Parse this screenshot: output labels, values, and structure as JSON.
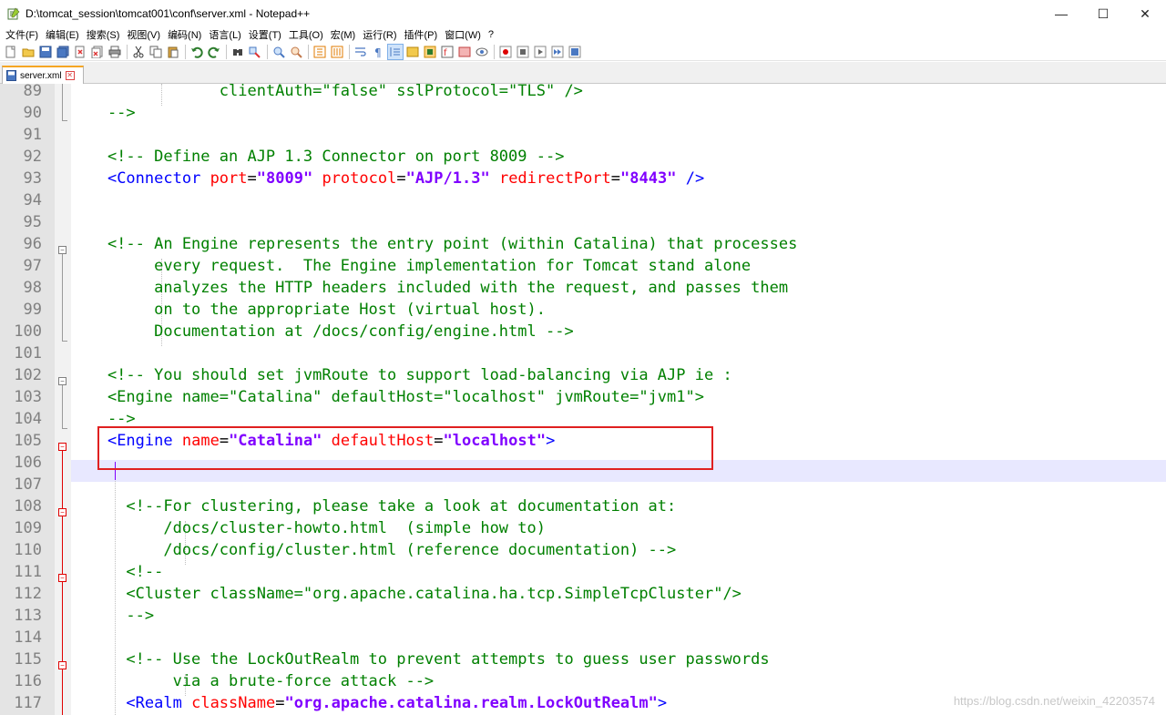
{
  "window": {
    "title": "D:\\tomcat_session\\tomcat001\\conf\\server.xml - Notepad++",
    "minimize": "—",
    "maximize": "☐",
    "close": "✕"
  },
  "menu": [
    "文件(F)",
    "编辑(E)",
    "搜索(S)",
    "视图(V)",
    "编码(N)",
    "语言(L)",
    "设置(T)",
    "工具(O)",
    "宏(M)",
    "运行(R)",
    "插件(P)",
    "窗口(W)",
    "?"
  ],
  "tab": {
    "label": "server.xml",
    "close": "✕"
  },
  "lines": [
    {
      "n": "89",
      "segs": [
        [
          "c-comment",
          "                clientAuth=\"false\" sslProtocol=\"TLS\" />"
        ]
      ]
    },
    {
      "n": "90",
      "segs": [
        [
          "c-comment",
          "    -->"
        ]
      ]
    },
    {
      "n": "91",
      "segs": []
    },
    {
      "n": "92",
      "segs": [
        [
          "c-comment",
          "    <!-- Define an AJP 1.3 Connector on port 8009 -->"
        ]
      ]
    },
    {
      "n": "93",
      "segs": [
        [
          "c-plain",
          "    "
        ],
        [
          "c-tag",
          "<Connector"
        ],
        [
          "c-plain",
          " "
        ],
        [
          "c-attr",
          "port"
        ],
        [
          "c-plain",
          "="
        ],
        [
          "c-val",
          "\"8009\""
        ],
        [
          "c-plain",
          " "
        ],
        [
          "c-attr",
          "protocol"
        ],
        [
          "c-plain",
          "="
        ],
        [
          "c-val",
          "\"AJP/1.3\""
        ],
        [
          "c-plain",
          " "
        ],
        [
          "c-attr",
          "redirectPort"
        ],
        [
          "c-plain",
          "="
        ],
        [
          "c-val",
          "\"8443\""
        ],
        [
          "c-plain",
          " "
        ],
        [
          "c-tag",
          "/>"
        ]
      ]
    },
    {
      "n": "94",
      "segs": []
    },
    {
      "n": "95",
      "segs": []
    },
    {
      "n": "96",
      "segs": [
        [
          "c-comment",
          "    <!-- An Engine represents the entry point (within Catalina) that processes"
        ]
      ]
    },
    {
      "n": "97",
      "segs": [
        [
          "c-comment",
          "         every request.  The Engine implementation for Tomcat stand alone"
        ]
      ]
    },
    {
      "n": "98",
      "segs": [
        [
          "c-comment",
          "         analyzes the HTTP headers included with the request, and passes them"
        ]
      ]
    },
    {
      "n": "99",
      "segs": [
        [
          "c-comment",
          "         on to the appropriate Host (virtual host)."
        ]
      ]
    },
    {
      "n": "100",
      "segs": [
        [
          "c-comment",
          "         Documentation at /docs/config/engine.html -->"
        ]
      ]
    },
    {
      "n": "101",
      "segs": []
    },
    {
      "n": "102",
      "segs": [
        [
          "c-comment",
          "    <!-- You should set jvmRoute to support load-balancing via AJP ie :"
        ]
      ]
    },
    {
      "n": "103",
      "segs": [
        [
          "c-comment",
          "    <Engine name=\"Catalina\" defaultHost=\"localhost\" jvmRoute=\"jvm1\">"
        ]
      ]
    },
    {
      "n": "104",
      "segs": [
        [
          "c-comment",
          "    -->"
        ]
      ]
    },
    {
      "n": "105",
      "segs": [
        [
          "c-plain",
          "    "
        ],
        [
          "c-tag",
          "<Engine"
        ],
        [
          "c-plain",
          " "
        ],
        [
          "c-attr",
          "name"
        ],
        [
          "c-plain",
          "="
        ],
        [
          "c-val",
          "\"Catalina\""
        ],
        [
          "c-plain",
          " "
        ],
        [
          "c-attr",
          "defaultHost"
        ],
        [
          "c-plain",
          "="
        ],
        [
          "c-val",
          "\"localhost\""
        ],
        [
          "c-tag",
          ">"
        ]
      ]
    },
    {
      "n": "106",
      "segs": []
    },
    {
      "n": "107",
      "segs": []
    },
    {
      "n": "108",
      "segs": [
        [
          "c-comment",
          "      <!--For clustering, please take a look at documentation at:"
        ]
      ]
    },
    {
      "n": "109",
      "segs": [
        [
          "c-comment",
          "          /docs/cluster-howto.html  (simple how to)"
        ]
      ]
    },
    {
      "n": "110",
      "segs": [
        [
          "c-comment",
          "          /docs/config/cluster.html (reference documentation) -->"
        ]
      ]
    },
    {
      "n": "111",
      "segs": [
        [
          "c-comment",
          "      <!--"
        ]
      ]
    },
    {
      "n": "112",
      "segs": [
        [
          "c-comment",
          "      <Cluster className=\"org.apache.catalina.ha.tcp.SimpleTcpCluster\"/>"
        ]
      ]
    },
    {
      "n": "113",
      "segs": [
        [
          "c-comment",
          "      -->"
        ]
      ]
    },
    {
      "n": "114",
      "segs": []
    },
    {
      "n": "115",
      "segs": [
        [
          "c-comment",
          "      <!-- Use the LockOutRealm to prevent attempts to guess user passwords"
        ]
      ]
    },
    {
      "n": "116",
      "segs": [
        [
          "c-comment",
          "           via a brute-force attack -->"
        ]
      ]
    },
    {
      "n": "117",
      "segs": [
        [
          "c-plain",
          "      "
        ],
        [
          "c-tag",
          "<Realm"
        ],
        [
          "c-plain",
          " "
        ],
        [
          "c-attr",
          "className"
        ],
        [
          "c-plain",
          "="
        ],
        [
          "c-val",
          "\"org.apache.catalina.realm.LockOutRealm\""
        ],
        [
          "c-tag",
          ">"
        ]
      ]
    }
  ],
  "watermark": "https://blog.csdn.net/weixin_42203574"
}
